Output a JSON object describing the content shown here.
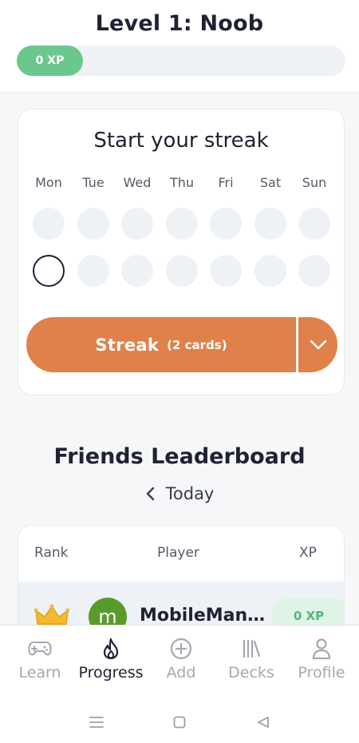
{
  "header": {
    "level_title": "Level 1: Noob",
    "xp_label": "0 XP",
    "xp_progress": 0
  },
  "streak": {
    "title": "Start your streak",
    "days": [
      "Mon",
      "Tue",
      "Wed",
      "Thu",
      "Fri",
      "Sat",
      "Sun"
    ],
    "button_label": "Streak",
    "button_sub": "(2 cards)",
    "dropdown_icon": "chevron-down-icon"
  },
  "leaderboard": {
    "title": "Friends Leaderboard",
    "period": "Today",
    "columns": {
      "rank": "Rank",
      "player": "Player",
      "xp": "XP"
    },
    "rows": [
      {
        "rank_icon": "crown-icon",
        "avatar_letter": "m",
        "name": "MobileMan...",
        "xp": "0 XP"
      }
    ]
  },
  "tabs": [
    {
      "label": "Learn",
      "icon": "gamepad-icon",
      "active": false
    },
    {
      "label": "Progress",
      "icon": "flame-icon",
      "active": true
    },
    {
      "label": "Add",
      "icon": "add-circle-icon",
      "active": false
    },
    {
      "label": "Decks",
      "icon": "library-icon",
      "active": false
    },
    {
      "label": "Profile",
      "icon": "user-icon",
      "active": false
    }
  ],
  "system_nav": [
    "menu-icon",
    "home-square-icon",
    "back-triangle-icon"
  ],
  "colors": {
    "accent": "#e0804a",
    "xp_green": "#6cc78c",
    "avatar_green": "#5a9a2c",
    "text_dark": "#1f2233"
  }
}
